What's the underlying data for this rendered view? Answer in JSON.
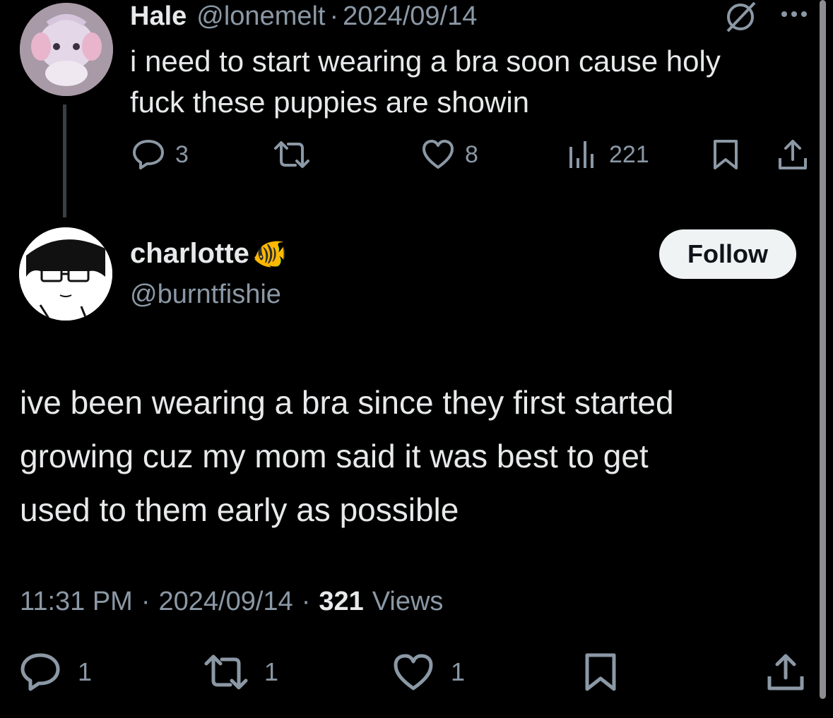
{
  "parent_post": {
    "display_name": "Hale",
    "handle": "@lonemelt",
    "separator": "·",
    "date": "2024/09/14",
    "text_line1": "i need to start wearing a bra soon cause holy",
    "text_line2": "fuck these puppies are showin",
    "stats": {
      "replies": "3",
      "likes": "8",
      "views": "221"
    },
    "icons": {
      "reply": "reply-icon",
      "repost": "repost-icon",
      "like": "heart-icon",
      "views": "views-chart-icon",
      "bookmark": "bookmark-icon",
      "share": "share-icon",
      "grok": "grok-icon",
      "more": "more-icon"
    }
  },
  "main_post": {
    "display_name": "charlotte",
    "name_emoji": "🐠",
    "handle": "@burntfishie",
    "follow_label": "Follow",
    "text_line1": "ive been wearing a bra since they first started",
    "text_line2": "growing cuz my mom said it was best to get",
    "text_line3": "used to them early as possible",
    "time": "11:31 PM",
    "sep1": "·",
    "date": "2024/09/14",
    "sep2": "·",
    "views_count": "321",
    "views_label": "Views",
    "stats": {
      "replies": "1",
      "reposts": "1",
      "likes": "1"
    }
  },
  "colors": {
    "background": "#000000",
    "text": "#e7e9ea",
    "muted": "#8b98a5",
    "follow_bg": "#eff3f4"
  }
}
